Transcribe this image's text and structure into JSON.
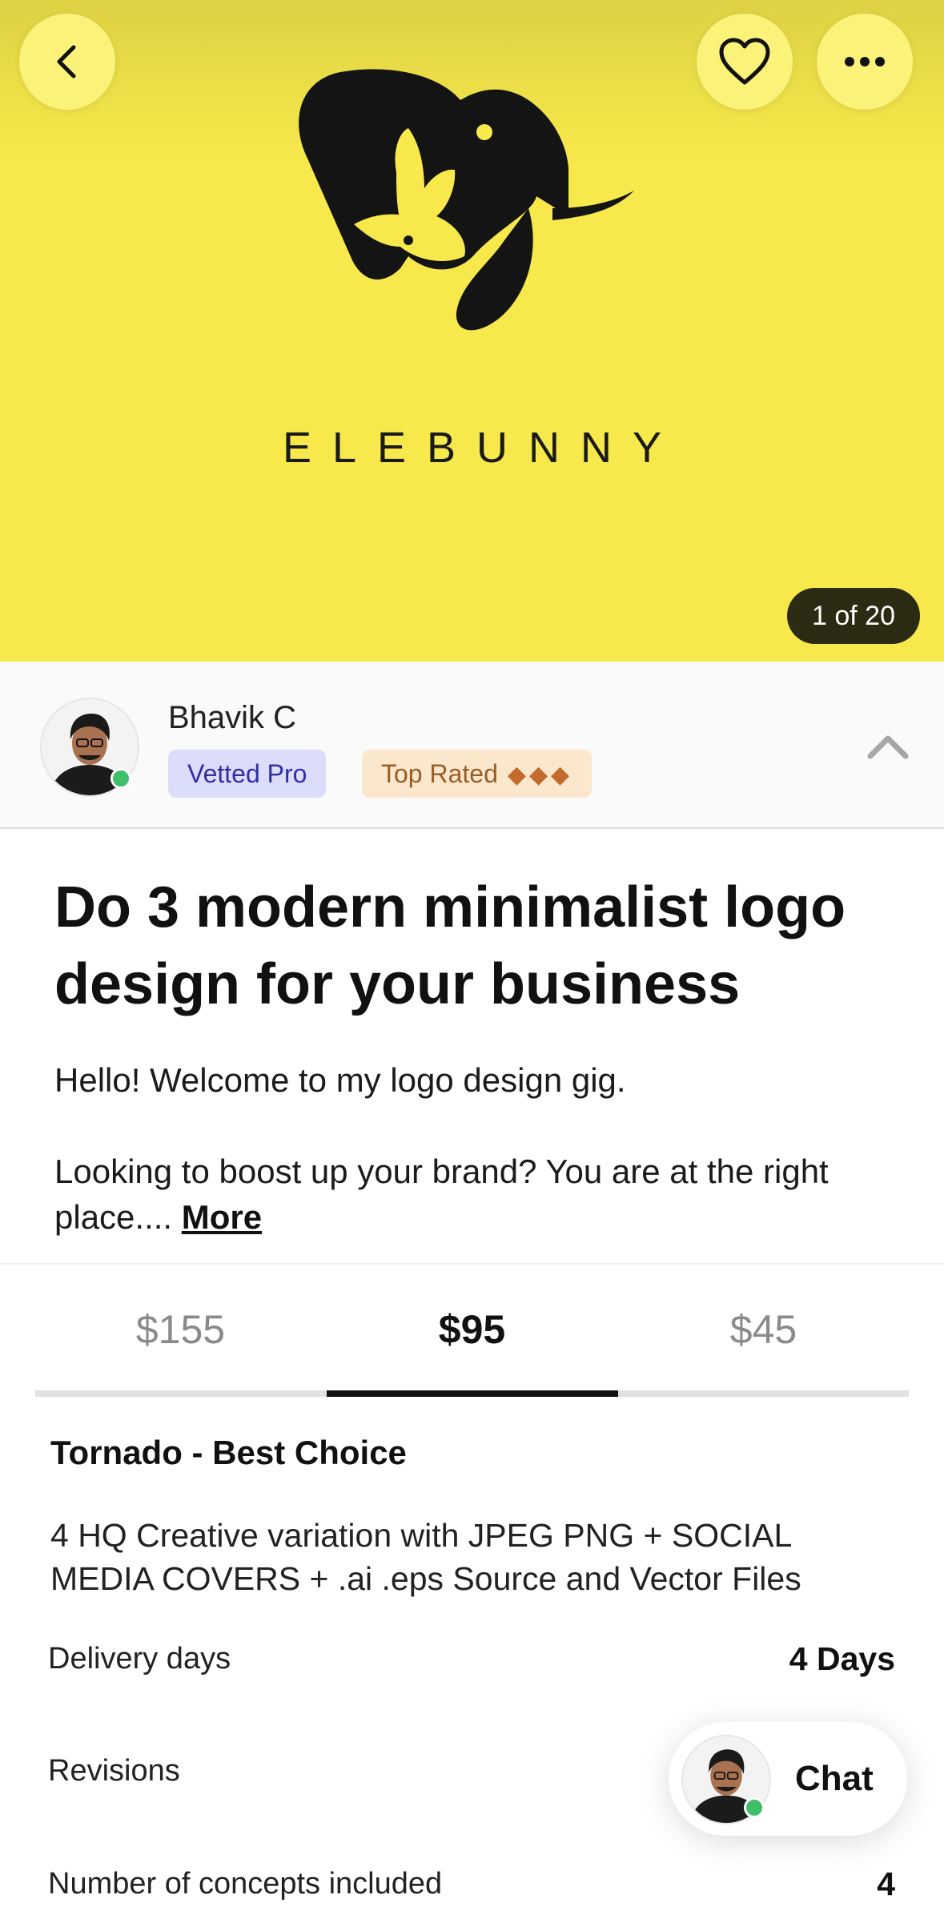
{
  "hero": {
    "brand_word": "ELEBUNNY",
    "image_counter": "1 of 20",
    "background_color": "#f7e94b"
  },
  "header_actions": {
    "back_icon": "chevron-left-icon",
    "favorite_icon": "heart-icon",
    "more_icon": "more-horizontal-icon"
  },
  "seller": {
    "name": "Bhavik C",
    "badges": {
      "vetted": "Vetted Pro",
      "top_rated": "Top Rated",
      "top_rated_marks": "◆◆◆"
    },
    "online": true,
    "collapse_icon": "chevron-up-icon"
  },
  "gig": {
    "title": "Do 3 modern minimalist logo design for your business",
    "description_line1": "Hello! Welcome to my logo design gig.",
    "description_line2": "Looking to boost up your brand? You are at the right place.... ",
    "more_label": "More"
  },
  "pricing": {
    "tabs": [
      {
        "label": "$155",
        "active": false
      },
      {
        "label": "$95",
        "active": true
      },
      {
        "label": "$45",
        "active": false
      }
    ],
    "package": {
      "title": "Tornado - Best Choice",
      "description": "4 HQ Creative variation with JPEG PNG + SOCIAL MEDIA COVERS + .ai .eps Source and Vector Files",
      "rows": [
        {
          "label": "Delivery days",
          "value": "4 Days"
        },
        {
          "label": "Revisions",
          "value": ""
        },
        {
          "label": "Number of concepts included",
          "value": "4"
        }
      ]
    }
  },
  "chat": {
    "label": "Chat"
  },
  "colors": {
    "hero_yellow": "#f7e94b",
    "vetted_badge_bg": "#dcdcfb",
    "top_rated_badge_bg": "#fbe8cc",
    "online_green": "#3fbf6a"
  }
}
